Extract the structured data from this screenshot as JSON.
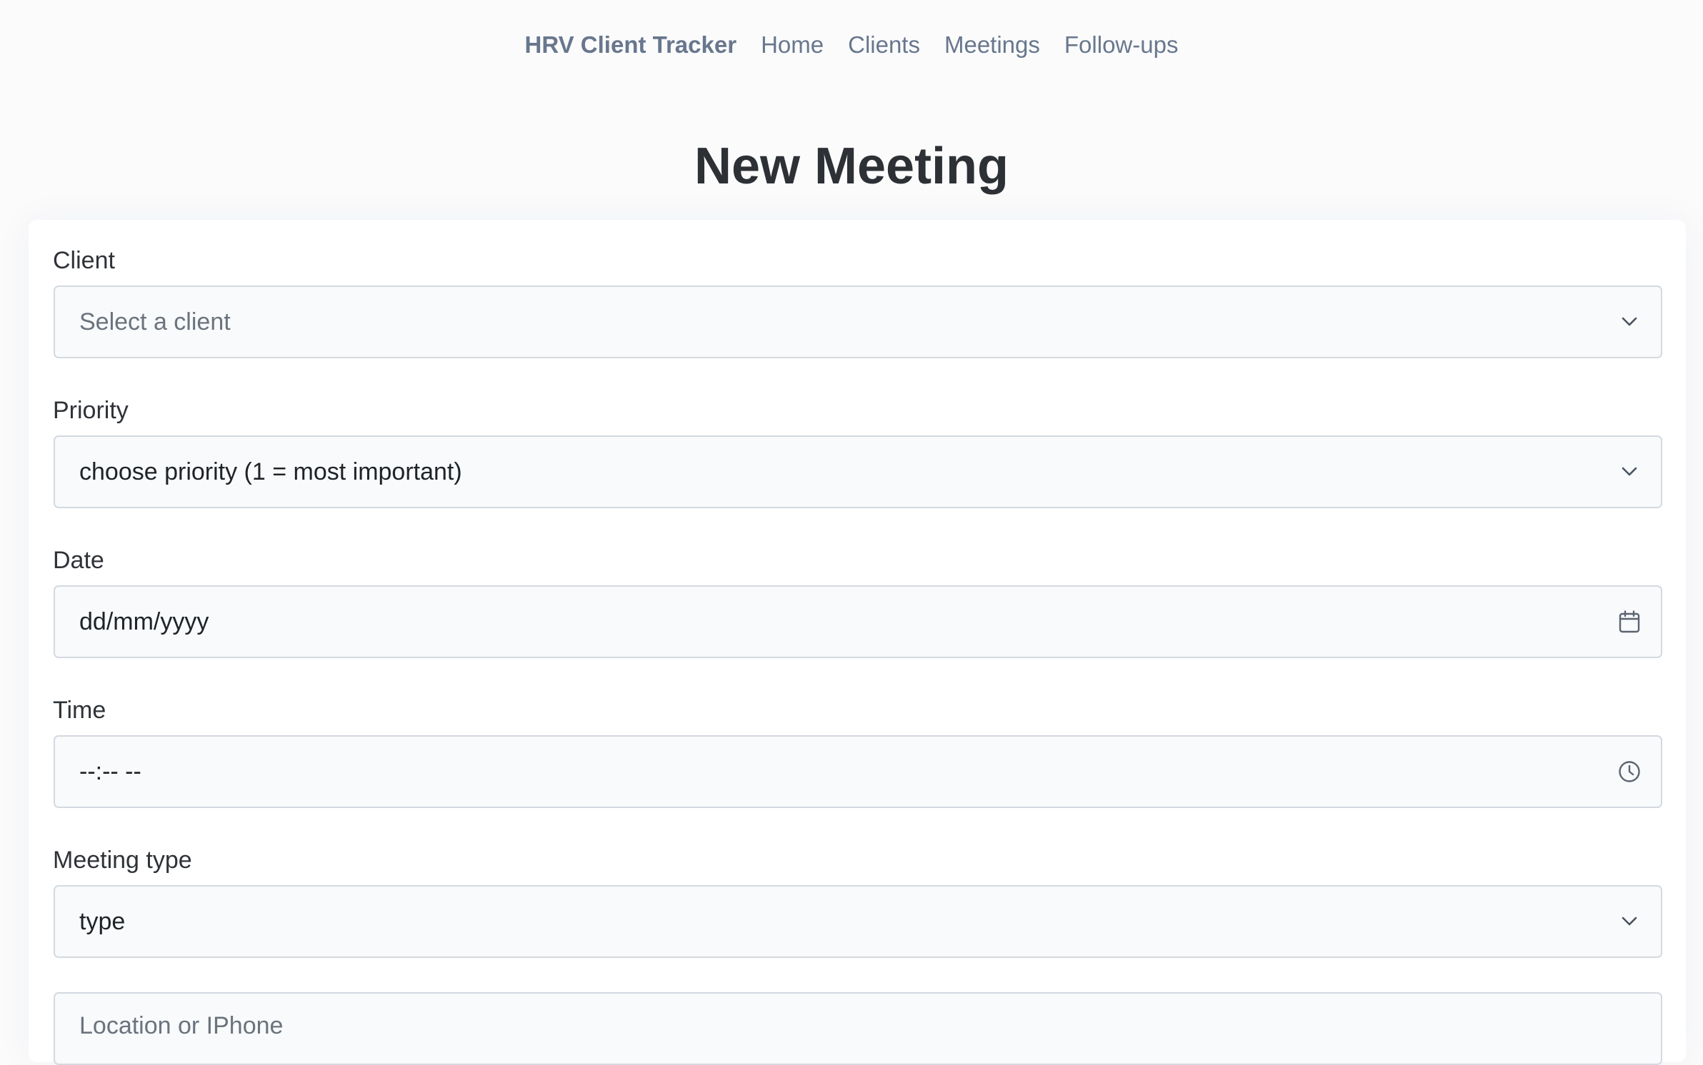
{
  "nav": {
    "brand": "HRV Client Tracker",
    "links": [
      "Home",
      "Clients",
      "Meetings",
      "Follow-ups"
    ]
  },
  "page": {
    "title": "New Meeting"
  },
  "form": {
    "client": {
      "label": "Client",
      "value": "Select a client",
      "icon": "chevron-down-icon"
    },
    "priority": {
      "label": "Priority",
      "value": "choose priority (1 = most important)",
      "icon": "chevron-down-icon"
    },
    "date": {
      "label": "Date",
      "value": "dd/mm/yyyy",
      "icon": "calendar-icon"
    },
    "time": {
      "label": "Time",
      "value": "--:-- --",
      "icon": "clock-icon"
    },
    "meeting_type": {
      "label": "Meeting type",
      "value": "type",
      "icon": "chevron-down-icon"
    },
    "location": {
      "placeholder": "Location or IPhone"
    }
  },
  "colors": {
    "nav_text": "#68778d",
    "title_text": "#2d3035",
    "field_border": "#d4d9e1",
    "field_bg": "#f8fafb",
    "page_bg": "#fbfbfc"
  }
}
